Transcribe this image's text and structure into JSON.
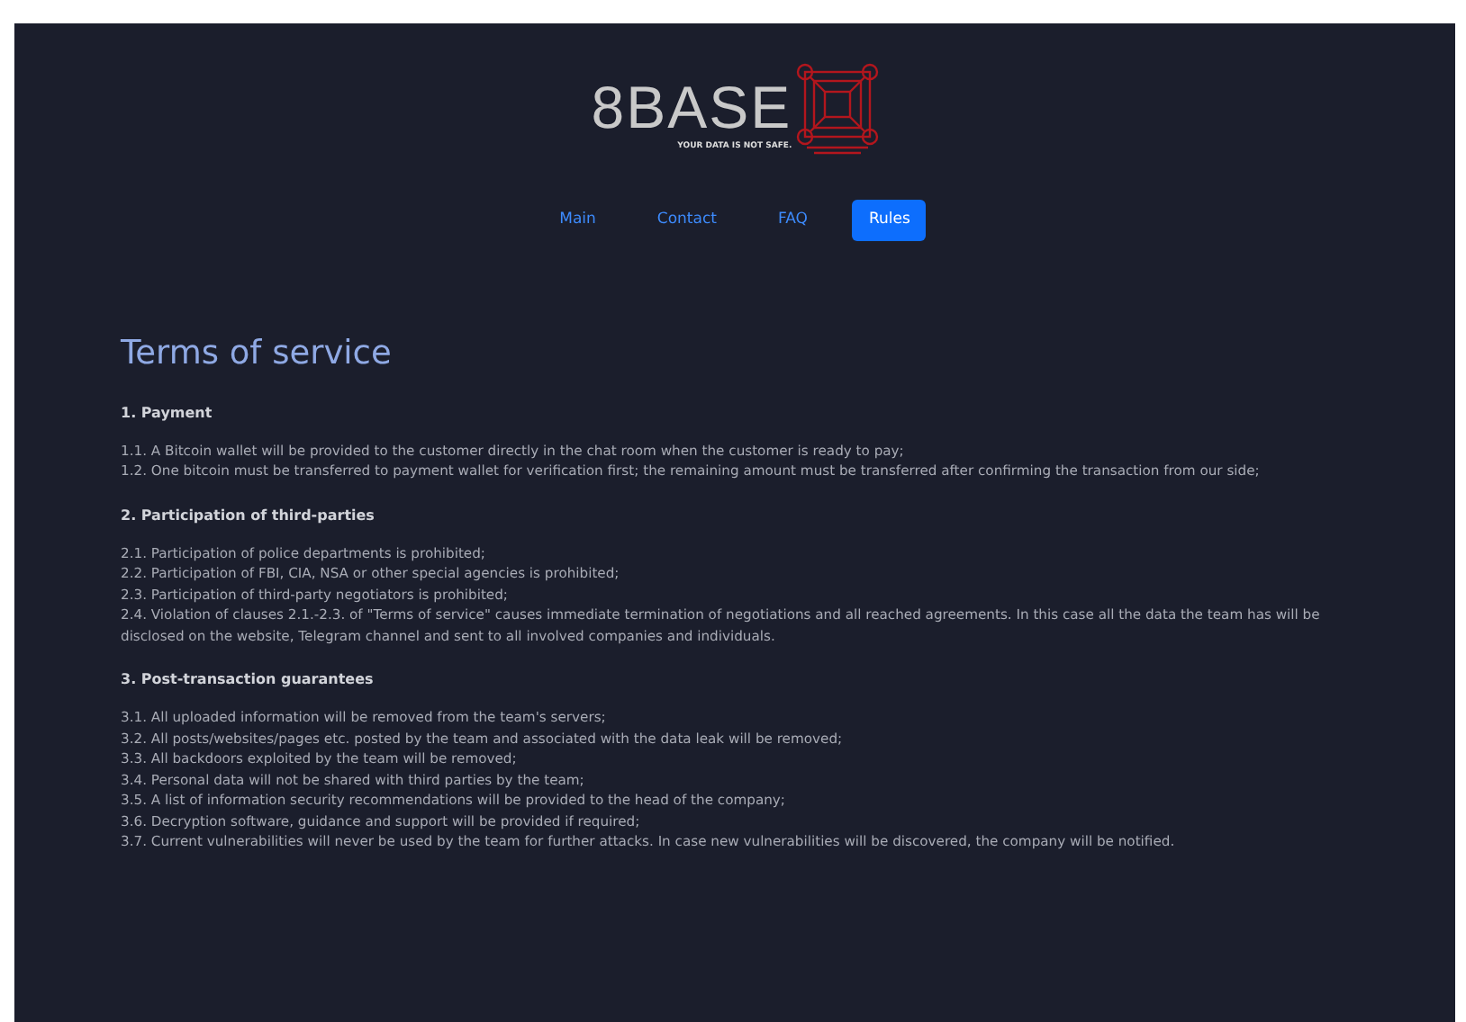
{
  "logo": {
    "text": "8BASE",
    "tagline": "YOUR DATA IS NOT SAFE."
  },
  "nav": [
    {
      "label": "Main",
      "selected": false
    },
    {
      "label": "Contact",
      "selected": false
    },
    {
      "label": "FAQ",
      "selected": false
    },
    {
      "label": "Rules",
      "selected": true
    }
  ],
  "title": "Terms of service",
  "sections": [
    {
      "heading": "1. Payment",
      "items": [
        "1.1. A Bitcoin wallet will be provided to the customer directly in the chat room when the customer is ready to pay;",
        "1.2. One bitcoin must be transferred to payment wallet for verification first; the remaining amount must be transferred after confirming the transaction from our side;"
      ]
    },
    {
      "heading": "2. Participation of third-parties",
      "items": [
        "2.1. Participation of police departments is prohibited;",
        "2.2. Participation of FBI, CIA, NSA or other special agencies is prohibited;",
        "2.3. Participation of third-party negotiators is prohibited;",
        "2.4. Violation of clauses 2.1.-2.3. of \"Terms of service\" causes immediate termination of negotiations and all reached agreements. In this case all the data the team has will be disclosed on the website, Telegram channel and sent to all involved companies and individuals."
      ]
    },
    {
      "heading": "3. Post-transaction guarantees",
      "items": [
        "3.1. All uploaded information will be removed from the team's servers;",
        "3.2. All posts/websites/pages etc. posted by the team and associated with the data leak will be removed;",
        "3.3. All backdoors exploited by the team will be removed;",
        "3.4. Personal data will not be shared with third parties by the team;",
        "3.5. A list of information security recommendations will be provided to the head of the company;",
        "3.6. Decryption software, guidance and support will be provided if required;",
        "3.7. Current vulnerabilities will never be used by the team for further attacks. In case new vulnerabilities will be discovered, the company will be notified."
      ]
    }
  ]
}
